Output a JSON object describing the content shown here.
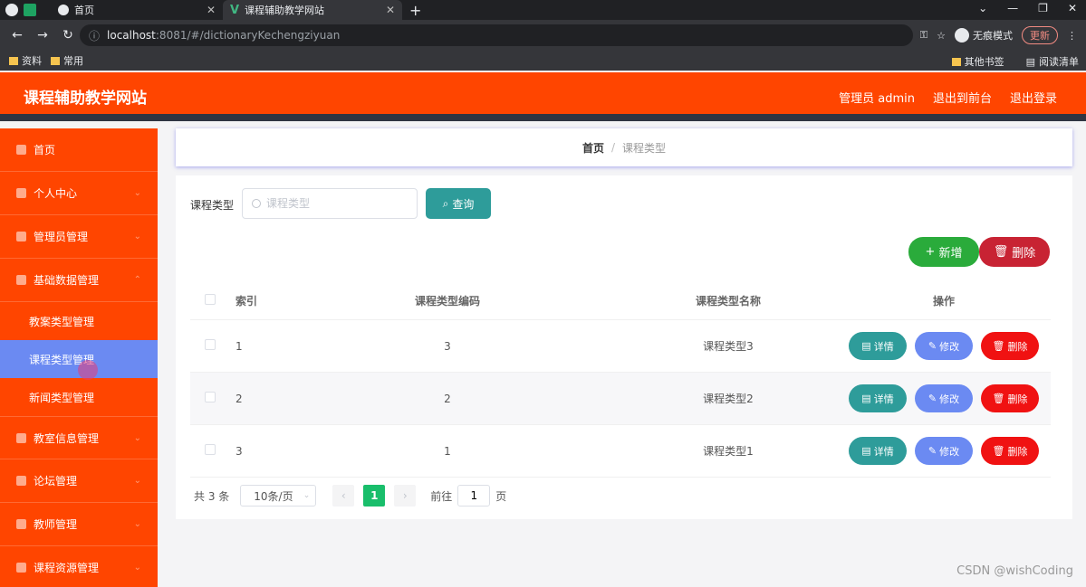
{
  "browser": {
    "tabs": [
      {
        "label": "首页"
      },
      {
        "label": "课程辅助教学网站"
      }
    ],
    "url_host": "localhost",
    "url_path": ":8081/#/dictionaryKechengziyuan",
    "incognito_label": "无痕模式",
    "update_label": "更新",
    "bookmarks": [
      "资料",
      "常用"
    ],
    "bookmarks_right": [
      "其他书签",
      "阅读清单"
    ]
  },
  "header": {
    "title": "课程辅助教学网站",
    "user": "管理员 admin",
    "to_front": "退出到前台",
    "logout": "退出登录"
  },
  "sidebar": {
    "items": [
      {
        "label": "首页"
      },
      {
        "label": "个人中心"
      },
      {
        "label": "管理员管理"
      },
      {
        "label": "基础数据管理"
      },
      {
        "label": "教室信息管理"
      },
      {
        "label": "论坛管理"
      },
      {
        "label": "教师管理"
      },
      {
        "label": "课程资源管理"
      }
    ],
    "subitems": [
      {
        "label": "教案类型管理"
      },
      {
        "label": "课程类型管理"
      },
      {
        "label": "新闻类型管理"
      }
    ]
  },
  "breadcrumb": {
    "home": "首页",
    "separator": "/",
    "current": "课程类型"
  },
  "search": {
    "label": "课程类型",
    "placeholder": "课程类型",
    "button": "查询"
  },
  "actions": {
    "add": "新增",
    "delete": "删除"
  },
  "table": {
    "headers": {
      "index": "索引",
      "code": "课程类型编码",
      "name": "课程类型名称",
      "ops": "操作"
    },
    "rows": [
      {
        "index": "1",
        "code": "3",
        "name": "课程类型3"
      },
      {
        "index": "2",
        "code": "2",
        "name": "课程类型2"
      },
      {
        "index": "3",
        "code": "1",
        "name": "课程类型1"
      }
    ],
    "op_labels": {
      "detail": "详情",
      "edit": "修改",
      "delete": "删除"
    }
  },
  "pagination": {
    "total": "共 3 条",
    "page_size": "10条/页",
    "current_page": "1",
    "goto_prefix": "前往",
    "goto_value": "1",
    "goto_suffix": "页"
  },
  "watermark": "CSDN @wishCoding"
}
